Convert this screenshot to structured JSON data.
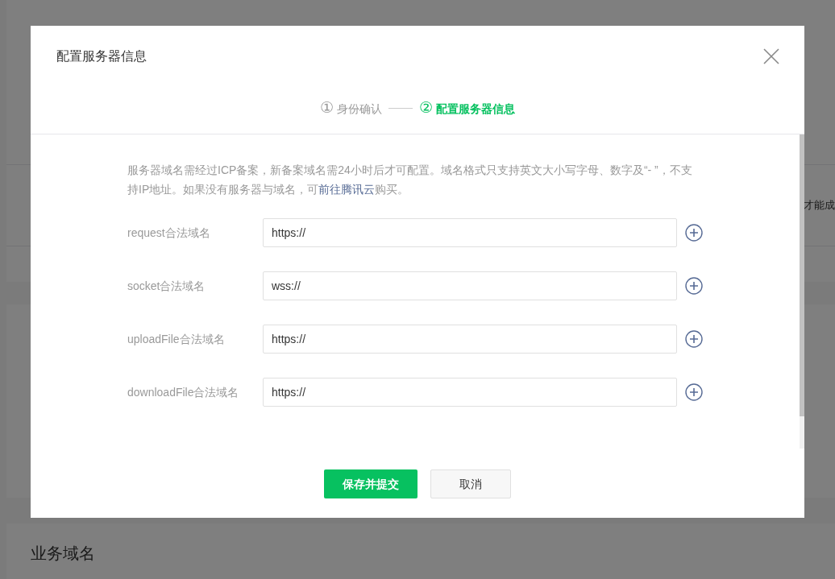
{
  "background": {
    "side_text": "才能成",
    "section_title": "业务域名"
  },
  "dialog": {
    "title": "配置服务器信息",
    "steps": [
      {
        "number": "①",
        "label": "身份确认",
        "selected": false
      },
      {
        "number": "②",
        "label": "配置服务器信息",
        "selected": true
      }
    ],
    "notice": "服务器域名需经过ICP备案，新备案域名需24小时后才可配置。域名格式只支持英文大小写字母、数字及“- ”，不支持IP地址。如果没有服务器与域名，可",
    "notice_link": "前往腾讯云",
    "notice_end": "购买。",
    "fields": [
      {
        "label": "request合法域名",
        "value": "https://"
      },
      {
        "label": "socket合法域名",
        "value": "wss://"
      },
      {
        "label": "uploadFile合法域名",
        "value": "https://"
      },
      {
        "label": "downloadFile合法域名",
        "value": "https://"
      }
    ],
    "buttons": [
      {
        "label": "保存并提交",
        "kind": "primary"
      },
      {
        "label": "取消",
        "kind": "default"
      }
    ]
  }
}
